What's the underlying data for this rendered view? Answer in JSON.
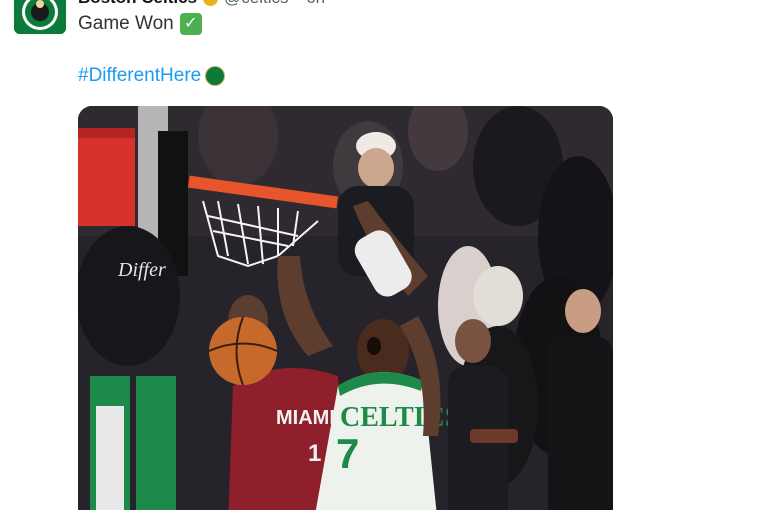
{
  "tweet": {
    "author": {
      "display_name": "Boston Celtics",
      "handle": "@celtics",
      "separator": "·",
      "time": "6h",
      "avatar_icon": "celtics-logo-icon",
      "verified_icon": "verified-badge-icon"
    },
    "text": "Game Won",
    "text_emoji": "✓",
    "hashtag": "#DifferentHere",
    "hashtag_emoji_icon": "shamrock-icon",
    "media": {
      "icon": "game-photo",
      "jersey_white_text": "CELTICS",
      "jersey_white_number": "7",
      "jersey_red_text": "MIAMI",
      "jersey_red_number": "1"
    }
  },
  "colors": {
    "link": "#1d9bf0",
    "celtics_green": "#0b7a3b",
    "heat_red": "#98002e",
    "rim_orange": "#e8552a"
  }
}
